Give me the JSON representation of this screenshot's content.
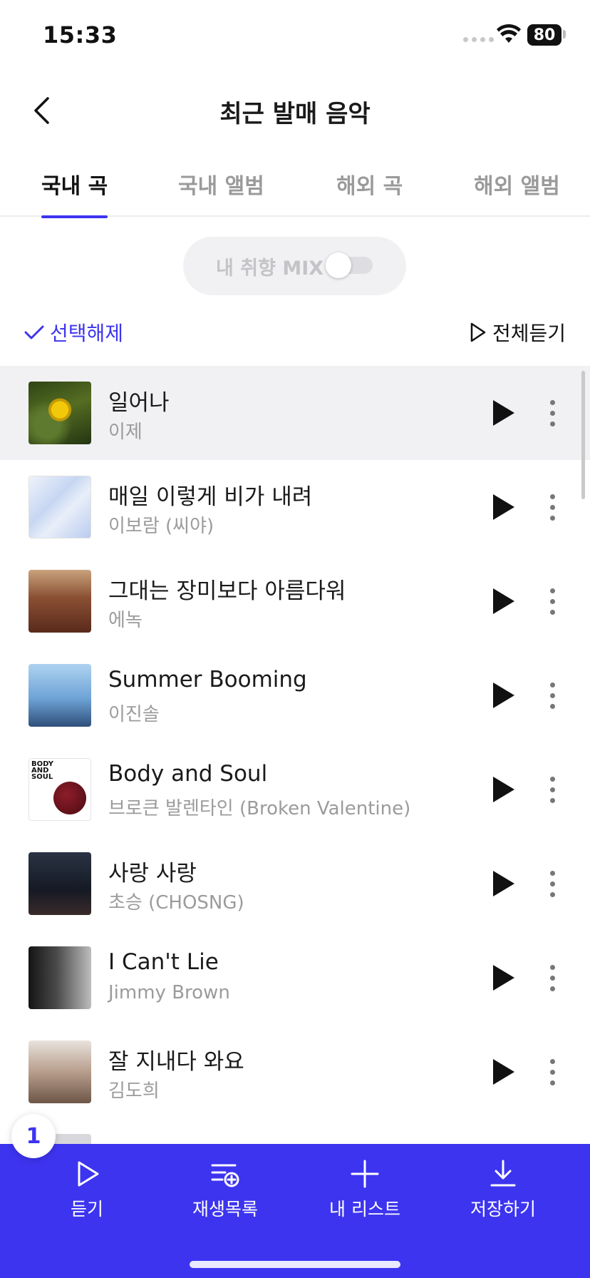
{
  "status_bar": {
    "time": "15:33",
    "battery": "80"
  },
  "header": {
    "title": "최근 발매 음악"
  },
  "tabs": [
    {
      "label": "국내 곡",
      "active": true
    },
    {
      "label": "국내 앨범",
      "active": false
    },
    {
      "label": "해외 곡",
      "active": false
    },
    {
      "label": "해외 앨범",
      "active": false
    }
  ],
  "mix": {
    "label": "내 취향 MIX",
    "enabled": false
  },
  "selection": {
    "deselect_label": "선택해제",
    "play_all_label": "전체듣기"
  },
  "songs": [
    {
      "title": "일어나",
      "artist": "이제",
      "selected": true
    },
    {
      "title": "매일 이렇게 비가 내려",
      "artist": "이보람 (씨야)",
      "selected": false
    },
    {
      "title": "그대는 장미보다 아름다워",
      "artist": "에녹",
      "selected": false
    },
    {
      "title": "Summer Booming",
      "artist": "이진솔",
      "selected": false
    },
    {
      "title": "Body and Soul",
      "artist": "브로큰 발렌타인 (Broken Valentine)",
      "selected": false
    },
    {
      "title": "사랑 사랑",
      "artist": "초승 (CHOSNG)",
      "selected": false
    },
    {
      "title": "I Can't Lie",
      "artist": "Jimmy Brown",
      "selected": false
    },
    {
      "title": "잘 지내다 와요",
      "artist": "김도희",
      "selected": false
    }
  ],
  "cover_text": {
    "body_and_soul": "BODY AND SOUL"
  },
  "selected_count": "1",
  "actions": [
    {
      "label": "듣기",
      "icon": "play-outline-icon"
    },
    {
      "label": "재생목록",
      "icon": "playlist-add-icon"
    },
    {
      "label": "내 리스트",
      "icon": "plus-icon"
    },
    {
      "label": "저장하기",
      "icon": "download-icon"
    }
  ],
  "colors": {
    "accent": "#3d34f0",
    "selected_row": "#f1f1f3",
    "muted_text": "#9b9b9b"
  }
}
